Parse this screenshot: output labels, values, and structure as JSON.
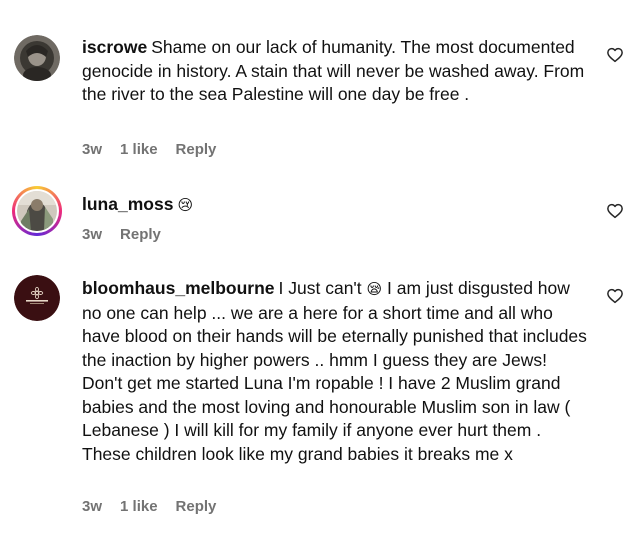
{
  "comments": [
    {
      "username": "iscrowe",
      "text": "Shame on our lack of humanity. The most documented genocide in history. A stain that will never be washed away. From the river to the sea Palestine will one day be free .",
      "age": "3w",
      "likes": "1 like",
      "reply": "Reply",
      "avatar_icon": "profile-photo"
    },
    {
      "username": "luna_moss",
      "text": "😢",
      "age": "3w",
      "likes": "",
      "reply": "Reply",
      "avatar_icon": "profile-photo-with-story-ring"
    },
    {
      "username": "bloomhaus_melbourne",
      "text_before_emoji": "I Just can't",
      "emoji": "😪",
      "text_after_emoji": "I am just disgusted how no one can help ... we are a here for a short time and all who have blood on their hands will be eternally punished that includes the inaction by higher powers .. hmm I guess they are Jews! Don't get me started Luna I'm ropable ! I have 2 Muslim grand babies and the most loving and honourable Muslim son in law ( Lebanese ) I will kill for my family if anyone ever hurt them . These children look like my grand babies it breaks me x",
      "age": "3w",
      "likes": "1 like",
      "reply": "Reply",
      "avatar_icon": "brand-logo"
    }
  ],
  "colors": {
    "text": "#111111",
    "meta": "#737373",
    "heart": "#262626"
  },
  "icons": {
    "like": "heart-outline-icon"
  }
}
